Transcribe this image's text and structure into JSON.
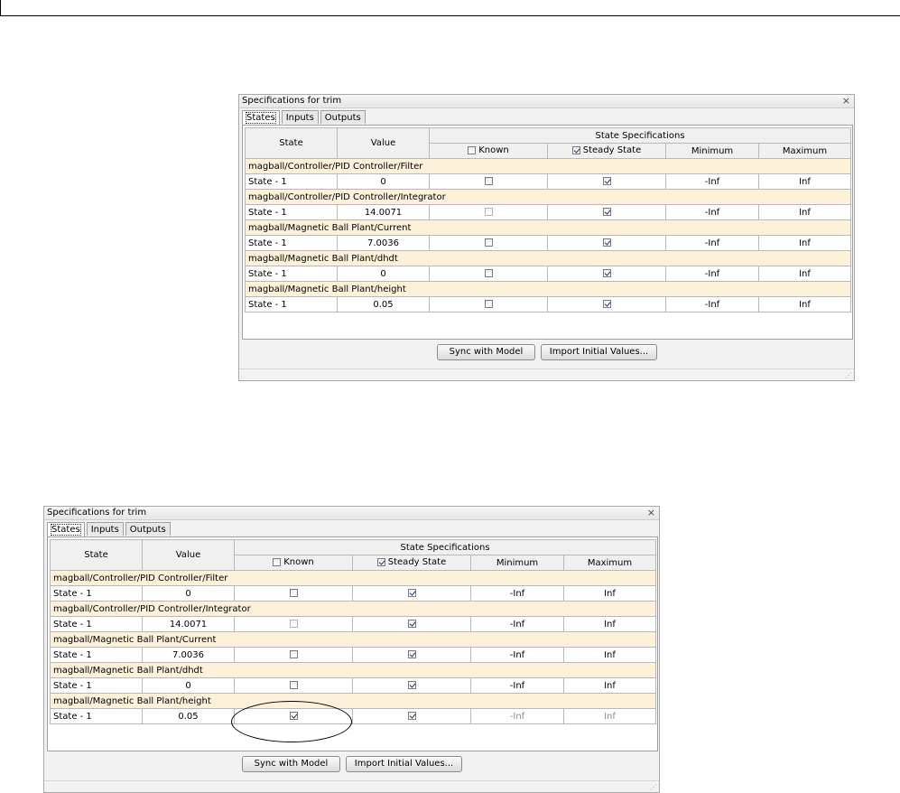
{
  "panels": [
    {
      "title": "Specifications for trim",
      "close": "×",
      "tabs": [
        "States",
        "Inputs",
        "Outputs"
      ],
      "headers": {
        "state": "State",
        "value": "Value",
        "spec": "State Specifications",
        "known": "Known",
        "steady": "Steady State",
        "min": "Minimum",
        "max": "Maximum"
      },
      "known_header_checked": false,
      "steady_header_checked": true,
      "groups": [
        {
          "block": "magball/Controller/PID Controller/Filter",
          "state": "State - 1",
          "value": "0",
          "known": false,
          "known_disabled": false,
          "steady": true,
          "min": "-Inf",
          "max": "Inf"
        },
        {
          "block": "magball/Controller/PID Controller/Integrator",
          "state": "State - 1",
          "value": "14.0071",
          "known": false,
          "known_disabled": true,
          "steady": true,
          "min": "-Inf",
          "max": "Inf"
        },
        {
          "block": "magball/Magnetic Ball Plant/Current",
          "state": "State - 1",
          "value": "7.0036",
          "known": false,
          "known_disabled": false,
          "steady": true,
          "min": "-Inf",
          "max": "Inf"
        },
        {
          "block": "magball/Magnetic Ball Plant/dhdt",
          "state": "State - 1",
          "value": "0",
          "known": false,
          "known_disabled": false,
          "steady": true,
          "min": "-Inf",
          "max": "Inf"
        },
        {
          "block": "magball/Magnetic Ball Plant/height",
          "state": "State - 1",
          "value": "0.05",
          "known": false,
          "known_disabled": false,
          "steady": true,
          "min": "-Inf",
          "max": "Inf"
        }
      ],
      "buttons": {
        "sync": "Sync with Model",
        "import": "Import Initial Values..."
      },
      "grip": "⋰"
    },
    {
      "title": "Specifications for trim",
      "close": "×",
      "tabs": [
        "States",
        "Inputs",
        "Outputs"
      ],
      "headers": {
        "state": "State",
        "value": "Value",
        "spec": "State Specifications",
        "known": "Known",
        "steady": "Steady State",
        "min": "Minimum",
        "max": "Maximum"
      },
      "known_header_checked": false,
      "steady_header_checked": true,
      "groups": [
        {
          "block": "magball/Controller/PID Controller/Filter",
          "state": "State - 1",
          "value": "0",
          "known": false,
          "known_disabled": false,
          "steady": true,
          "min": "-Inf",
          "max": "Inf"
        },
        {
          "block": "magball/Controller/PID Controller/Integrator",
          "state": "State - 1",
          "value": "14.0071",
          "known": false,
          "known_disabled": true,
          "steady": true,
          "min": "-Inf",
          "max": "Inf"
        },
        {
          "block": "magball/Magnetic Ball Plant/Current",
          "state": "State - 1",
          "value": "7.0036",
          "known": false,
          "known_disabled": false,
          "steady": true,
          "min": "-Inf",
          "max": "Inf"
        },
        {
          "block": "magball/Magnetic Ball Plant/dhdt",
          "state": "State - 1",
          "value": "0",
          "known": false,
          "known_disabled": false,
          "steady": true,
          "min": "-Inf",
          "max": "Inf"
        },
        {
          "block": "magball/Magnetic Ball Plant/height",
          "state": "State - 1",
          "value": "0.05",
          "known": true,
          "known_disabled": false,
          "steady": true,
          "min": "-Inf",
          "max": "Inf",
          "minmax_dimmed": true
        }
      ],
      "buttons": {
        "sync": "Sync with Model",
        "import": "Import Initial Values..."
      },
      "grip": "⋰"
    }
  ],
  "colors": {
    "group_row": "#fdf1d9",
    "panel_bg": "#f2f2f2",
    "header_bg": "#f0f0f0"
  }
}
